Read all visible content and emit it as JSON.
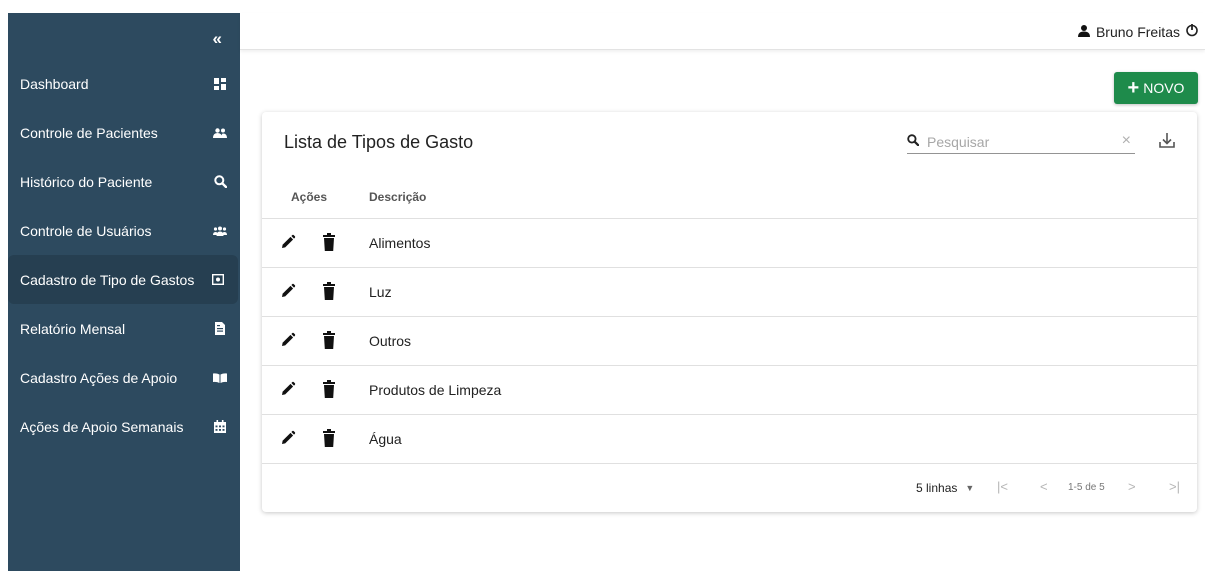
{
  "sidebar": {
    "collapse_glyph": "«",
    "items": [
      {
        "label": "Dashboard",
        "icon": "dashboard-icon"
      },
      {
        "label": "Controle de Pacientes",
        "icon": "users-icon"
      },
      {
        "label": "Histórico do Paciente",
        "icon": "search-icon"
      },
      {
        "label": "Controle de Usuários",
        "icon": "users-cog-icon"
      },
      {
        "label": "Cadastro de Tipo de Gastos",
        "icon": "money-icon",
        "active": true
      },
      {
        "label": "Relatório Mensal",
        "icon": "file-report-icon"
      },
      {
        "label": "Cadastro Ações de Apoio",
        "icon": "book-open-icon"
      },
      {
        "label": "Ações de Apoio Semanais",
        "icon": "calendar-icon"
      }
    ]
  },
  "topbar": {
    "user_name": "Bruno Freitas"
  },
  "actions": {
    "new_label": "NOVO",
    "new_glyph": "+"
  },
  "table": {
    "title": "Lista de Tipos de Gasto",
    "search_placeholder": "Pesquisar",
    "clear_glyph": "×",
    "columns": [
      "Ações",
      "Descrição"
    ],
    "rows": [
      {
        "description": "Alimentos"
      },
      {
        "description": "Luz"
      },
      {
        "description": "Outros"
      },
      {
        "description": "Produtos de Limpeza"
      },
      {
        "description": "Água"
      }
    ]
  },
  "pagination": {
    "rows_per_page": "5 linhas",
    "range": "1-5 de 5",
    "first_glyph": "|<",
    "prev_glyph": "<",
    "next_glyph": ">",
    "last_glyph": ">|"
  },
  "colors": {
    "sidebar_bg": "#2d4a5f",
    "sidebar_active": "#263f51",
    "accent_green": "#1e8b4b"
  }
}
